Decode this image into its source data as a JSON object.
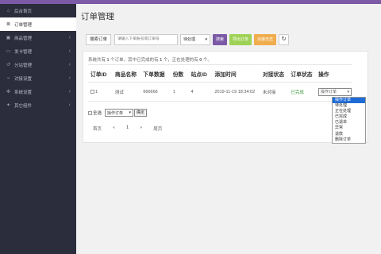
{
  "sidebar": {
    "items": [
      {
        "icon": "home-icon",
        "glyph": "⌂",
        "label": "后台首页",
        "active": false,
        "chevron": false
      },
      {
        "icon": "list-icon",
        "glyph": "≣",
        "label": "订单管理",
        "active": true,
        "chevron": false
      },
      {
        "icon": "cart-icon",
        "glyph": "▣",
        "label": "商品管理",
        "active": false,
        "chevron": true
      },
      {
        "icon": "card-icon",
        "glyph": "▭",
        "label": "发卡管理",
        "active": false,
        "chevron": true
      },
      {
        "icon": "share-icon",
        "glyph": "↺",
        "label": "分站管理",
        "active": false,
        "chevron": true
      },
      {
        "icon": "plug-icon",
        "glyph": "⌁",
        "label": "对接设置",
        "active": false,
        "chevron": true
      },
      {
        "icon": "gear-icon",
        "glyph": "✻",
        "label": "系统设置",
        "active": false,
        "chevron": true
      },
      {
        "icon": "puzzle-icon",
        "glyph": "✦",
        "label": "其它组件",
        "active": false,
        "chevron": true
      }
    ]
  },
  "main": {
    "title": "订单管理",
    "toolbar": {
      "search_label": "搜索订单",
      "search_placeholder": "请输入下单账号或订单号",
      "status_value": "待处理",
      "search_button": "搜索",
      "export_button": "导出订单",
      "log_button": "对接日志",
      "refresh_icon": "refresh-icon"
    },
    "summary": {
      "p1": "系统共有 ",
      "total": "1",
      "p2": " 个订单，其中已完成的有 ",
      "completed": "1",
      "p3": " 个，正在处理的有 ",
      "processing": "0",
      "p4": " 个。"
    },
    "table": {
      "headers": [
        "订单ID",
        "商品名称",
        "下单数据",
        "份数",
        "站点ID",
        "添加时间",
        "对接状态",
        "订单状态",
        "操作"
      ],
      "rows": [
        {
          "id": "1",
          "product": "测试",
          "data": "666666",
          "count": "1",
          "site": "4",
          "time": "2019-11-19 18:34:02",
          "dock_status": "未对接",
          "order_status": "已完成",
          "action": "操作订单"
        }
      ]
    },
    "dropdown": {
      "options": [
        "操作订单",
        "待处理",
        "正在处理",
        "已完成",
        "已退单",
        "异常",
        "退款",
        "删除订单"
      ],
      "selected_index": 0
    },
    "bulk": {
      "select_all_label": "全选",
      "select_value": "操作订单",
      "confirm_label": "确定"
    },
    "pager": {
      "first": "首页",
      "prev": "«",
      "current": "1",
      "next": "»",
      "last": "尾页"
    },
    "colors": {
      "accent": "#7b5aa6",
      "export": "#9ed257",
      "log": "#f0ad4e",
      "status_ok": "#3ca03c",
      "selected_option": "#1e6bd6"
    }
  }
}
